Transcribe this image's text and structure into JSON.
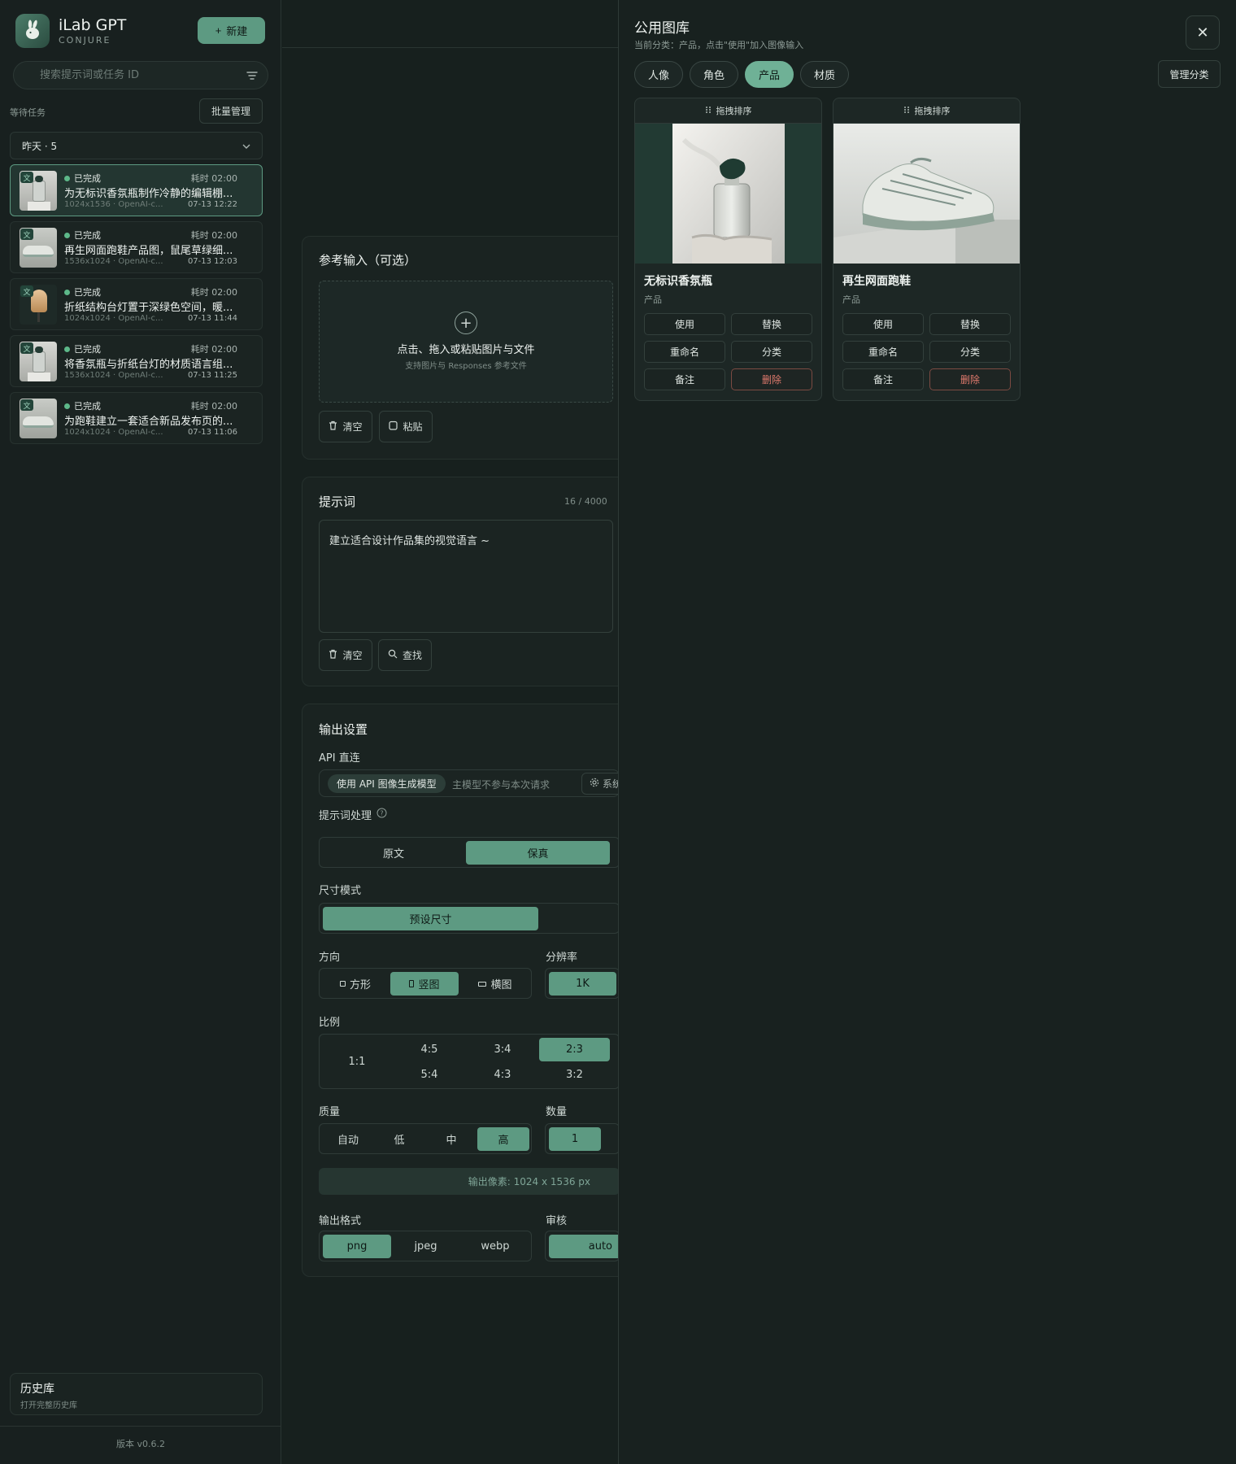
{
  "brand": {
    "title": "iLab GPT",
    "subtitle": "CONJURE",
    "new_label": "新建"
  },
  "sidebar": {
    "search_placeholder": "搜索提示词或任务 ID",
    "waiting_label": "等待任务",
    "batch_label": "批量管理",
    "group_label": "昨天 · 5",
    "tasks": [
      {
        "tag": "文",
        "status": "已完成",
        "elapsed": "耗时 02:00",
        "title": "为无标识香氛瓶制作冷静的编辑棚...",
        "meta": "1024x1536 · OpenAI-c...",
        "date": "07-13 12:22",
        "active": true
      },
      {
        "tag": "文",
        "status": "已完成",
        "elapsed": "耗时 02:00",
        "title": "再生网面跑鞋产品图，鼠尾草绿细...",
        "meta": "1536x1024 · OpenAI-c...",
        "date": "07-13 12:03"
      },
      {
        "tag": "文",
        "status": "已完成",
        "elapsed": "耗时 02:00",
        "title": "折纸结构台灯置于深绿色空间，暖...",
        "meta": "1024x1024 · OpenAI-c...",
        "date": "07-13 11:44"
      },
      {
        "tag": "文",
        "status": "已完成",
        "elapsed": "耗时 02:00",
        "title": "将香氛瓶与折纸台灯的材质语言组...",
        "meta": "1536x1024 · OpenAI-c...",
        "date": "07-13 11:25"
      },
      {
        "tag": "文",
        "status": "已完成",
        "elapsed": "耗时 02:00",
        "title": "为跑鞋建立一套适合新品发布页的...",
        "meta": "1024x1024 · OpenAI-c...",
        "date": "07-13 11:06"
      }
    ],
    "history_title": "历史库",
    "history_sub": "打开完整历史库",
    "version": "版本 v0.6.2"
  },
  "reference": {
    "title": "参考输入（可选）",
    "drop_title": "点击、拖入或粘贴图片与文件",
    "drop_sub": "支持图片与 Responses 参考文件",
    "clear_label": "清空",
    "paste_label": "粘贴"
  },
  "prompt": {
    "title": "提示词",
    "counter": "16 / 4000",
    "value": "建立适合设计作品集的视觉语言 ~",
    "clear_label": "清空",
    "find_label": "查找"
  },
  "output": {
    "title": "输出设置",
    "api_label": "API 直连",
    "api_pill": "使用 API 图像生成模型",
    "api_note": "主模型不参与本次请求",
    "api_sys": "系统",
    "prompt_proc_label": "提示词处理",
    "prompt_proc_options": [
      "原文",
      "保真"
    ],
    "size_mode_label": "尺寸模式",
    "size_mode_options": [
      "预设尺寸"
    ],
    "direction_label": "方向",
    "direction_options": [
      "方形",
      "竖图",
      "横图"
    ],
    "resolution_label": "分辨率",
    "resolution_value": "1K",
    "ratio_label": "比例",
    "ratios": {
      "square": "1:1",
      "r1": "4:5",
      "r2": "3:4",
      "r3": "2:3",
      "r4": "5:4",
      "r5": "4:3",
      "r6": "3:2"
    },
    "quality_label": "质量",
    "quality_options": [
      "自动",
      "低",
      "中",
      "高"
    ],
    "count_label": "数量",
    "count_value": "1",
    "pixels": "输出像素: 1024 x 1536 px",
    "format_label": "输出格式",
    "format_options": [
      "png",
      "jpeg",
      "webp"
    ],
    "moderation_label": "审核",
    "moderation_value": "auto"
  },
  "gallery": {
    "title": "公用图库",
    "subtitle": "当前分类：产品，点击\"使用\"加入图像输入",
    "categories": [
      "人像",
      "角色",
      "产品",
      "材质"
    ],
    "active_category": "产品",
    "manage_label": "管理分类",
    "drag_label": "拖拽排序",
    "cards": [
      {
        "name": "无标识香氛瓶",
        "category": "产品"
      },
      {
        "name": "再生网面跑鞋",
        "category": "产品"
      }
    ],
    "actions": {
      "use": "使用",
      "replace": "替换",
      "rename": "重命名",
      "classify": "分类",
      "note": "备注",
      "delete": "删除"
    }
  },
  "colors": {
    "accent": "#5d9a82",
    "bg": "#17201e",
    "danger": "#e07a6d"
  }
}
